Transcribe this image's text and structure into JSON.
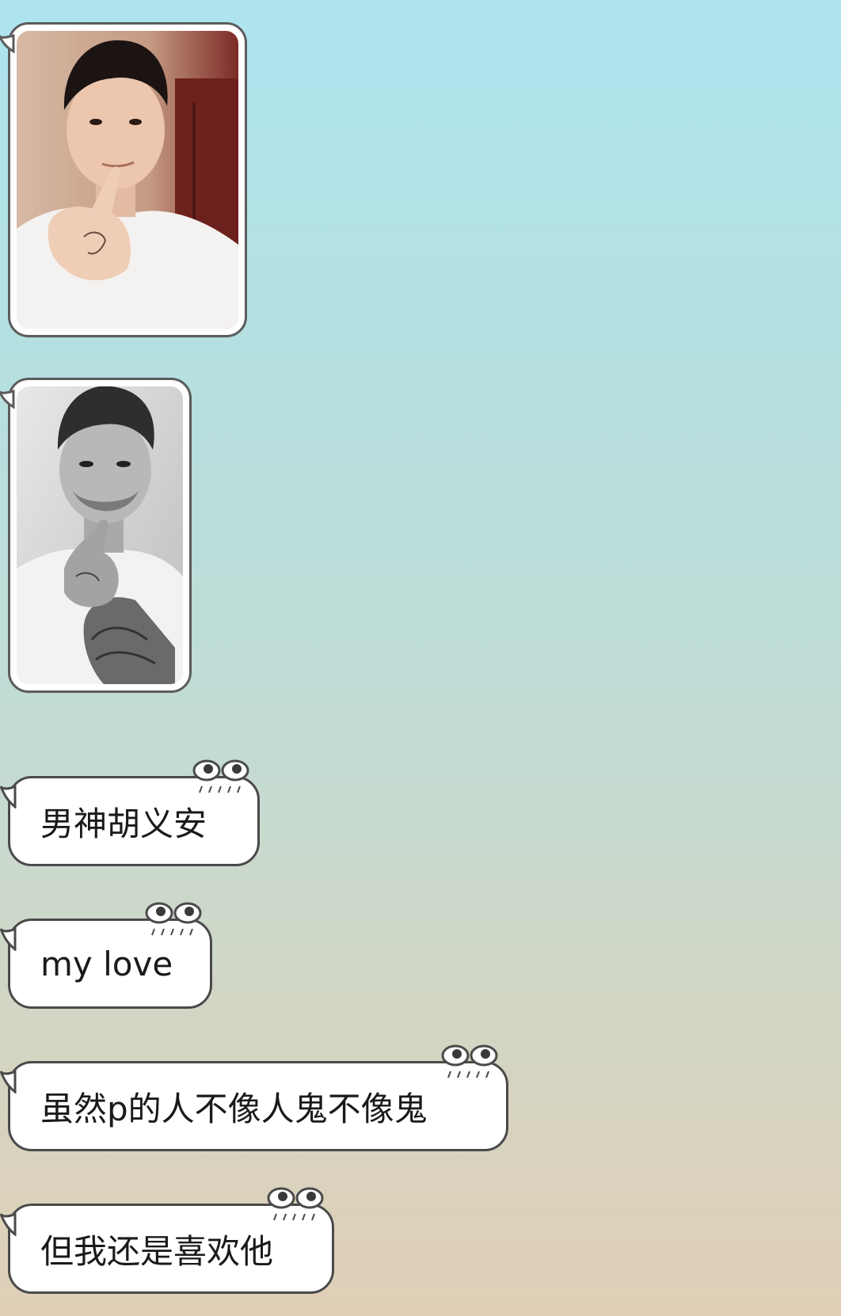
{
  "app": {
    "theme": {
      "bubble_fill": "#ffffff",
      "bubble_border": "#4a4a4a",
      "background_top": "#aee4ee",
      "background_bottom": "#e0cfb6"
    }
  },
  "messages": [
    {
      "type": "image",
      "description_icon": "photo-young-man-selfie"
    },
    {
      "type": "image",
      "description_icon": "photo-man-black-white"
    },
    {
      "type": "text",
      "text": "男神胡义安"
    },
    {
      "type": "text",
      "text": "my love"
    },
    {
      "type": "text",
      "text": "虽然p的人不像人鬼不像鬼"
    },
    {
      "type": "text",
      "text": "但我还是喜欢他"
    }
  ]
}
